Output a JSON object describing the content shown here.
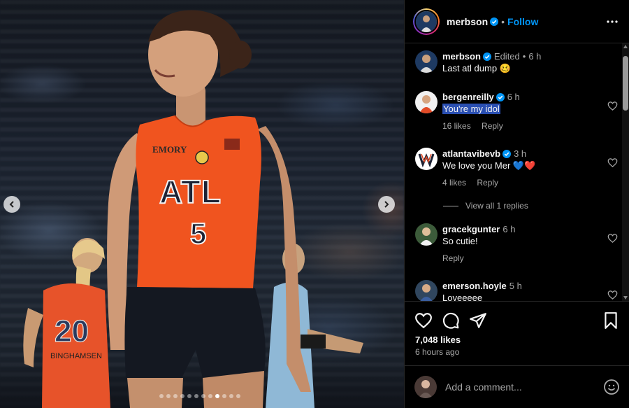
{
  "post": {
    "image_alt_icon": "photo-carousel",
    "carousel": {
      "total": 12,
      "current": 9
    }
  },
  "header": {
    "username": "merbson",
    "separator": "•",
    "follow_label": "Follow"
  },
  "caption": {
    "username": "merbson",
    "edited": "Edited",
    "separator": "•",
    "time": "6 h",
    "text": "Last atl dump 🥴"
  },
  "comments": [
    {
      "username": "bergenreilly",
      "time": "6 h",
      "text": "You're my idol",
      "likes": "16 likes",
      "reply": "Reply",
      "selected": true
    },
    {
      "username": "atlantavibevb",
      "time": "3 h",
      "text": "We love you Mer 💙❤️",
      "likes": "4 likes",
      "reply": "Reply"
    },
    {
      "username": "gracekgunter",
      "time": "6 h",
      "text": "So cutie!",
      "reply": "Reply"
    },
    {
      "username": "emerson.hoyle",
      "time": "5 h",
      "text": "Loveeeee"
    }
  ],
  "view_replies": "View all 1 replies",
  "stats": {
    "likes": "7,048 likes",
    "time_ago": "6 hours ago"
  },
  "add_comment": {
    "placeholder": "Add a comment..."
  },
  "colors": {
    "accent": "#0095f6",
    "jersey": "#f0541f",
    "background": "#000000",
    "selection": "#2a4fb2"
  }
}
